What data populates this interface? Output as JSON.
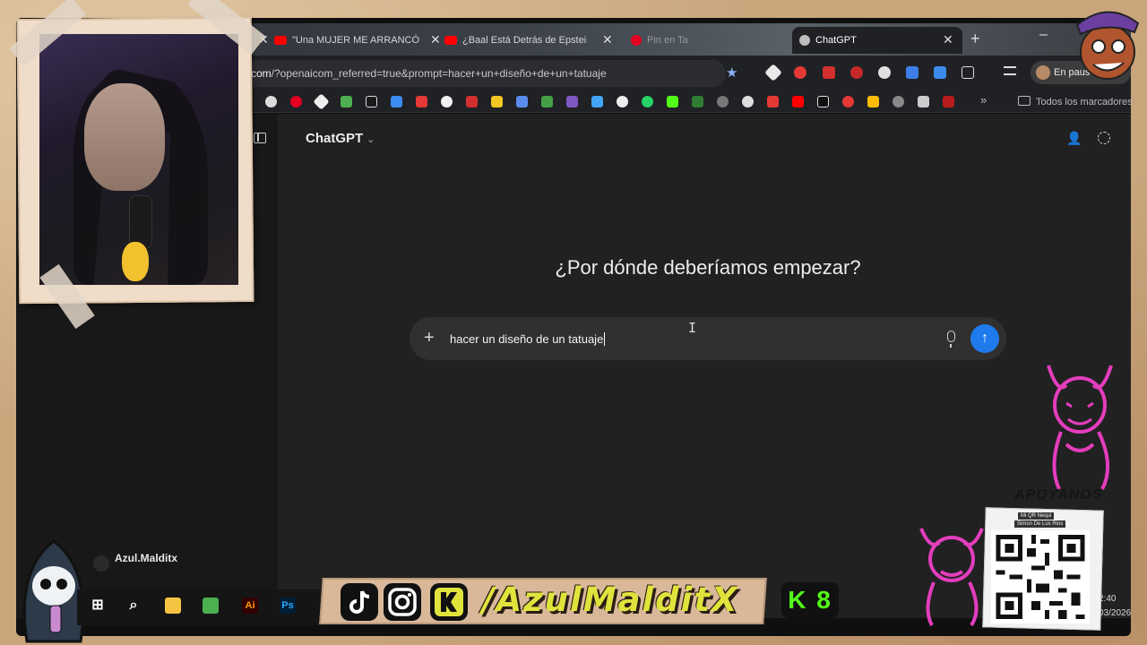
{
  "browser": {
    "tabs": [
      {
        "title": "\"Una MUJER ME ARRANCÓ",
        "icon": "youtube-icon"
      },
      {
        "title": "¿Baal Está Detrás de Epstei",
        "icon": "youtube-icon"
      },
      {
        "title": "Pin en Ta",
        "icon": "pinterest-icon"
      },
      {
        "title": "ChatGPT",
        "icon": "openai-icon",
        "active": true
      }
    ],
    "url_host": "com",
    "url_rest": "/?openaicom_referred=true&prompt=hacer+un+diseño+de+un+tatuaje",
    "profile_status": "En paus",
    "bookmarks_folder": "Todos los marcadores"
  },
  "chatgpt": {
    "model": "ChatGPT",
    "headline": "¿Por dónde deberíamos empezar?",
    "prompt": "hacer un diseño de un tatuaje",
    "plus": "+",
    "send": "↑"
  },
  "overlay": {
    "viewer_name": "Azul.Malditx",
    "handle": "/AzulMalditX",
    "kick_badge": "K 8",
    "support_title": "APOYANOS",
    "qr_caption": "Mi QR Nequi",
    "qr_name": "Simon De Los Rios",
    "clock_time": "2:40",
    "clock_date": "03/2026"
  },
  "colors": {
    "accent": "#1f7aec",
    "frame": "#c9a57c",
    "handle": "#e0e33c",
    "kick": "#53fc18"
  }
}
